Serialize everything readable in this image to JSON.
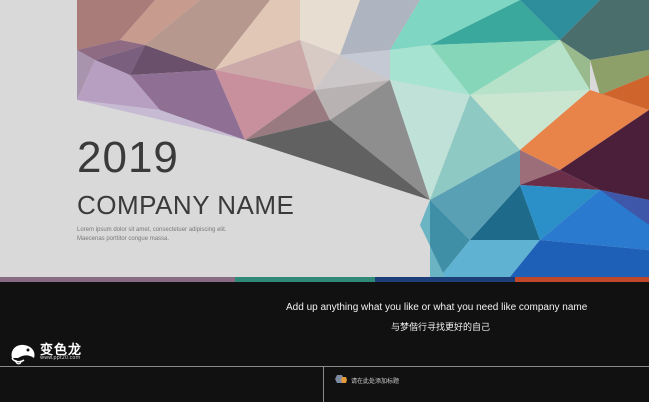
{
  "slide": {
    "year": "2019",
    "company": "COMPANY  NAME",
    "lorem": "Lorem ipsum dolor sit amet, consectetuer adipiscing elit. Maecenas porttitor congue massa.",
    "tagline_en": "Add up anything what you like or what you need like company name",
    "tagline_cn": "与梦偕行寻找更好的自己"
  },
  "footer": {
    "placeholder": "请在此处添加标题"
  },
  "logo": {
    "title": "变色龙",
    "url": "www.ppt20.com"
  },
  "colors": {
    "band": [
      "#8a6b86",
      "#2f8a78",
      "#1c3f7a",
      "#c1472b"
    ]
  }
}
